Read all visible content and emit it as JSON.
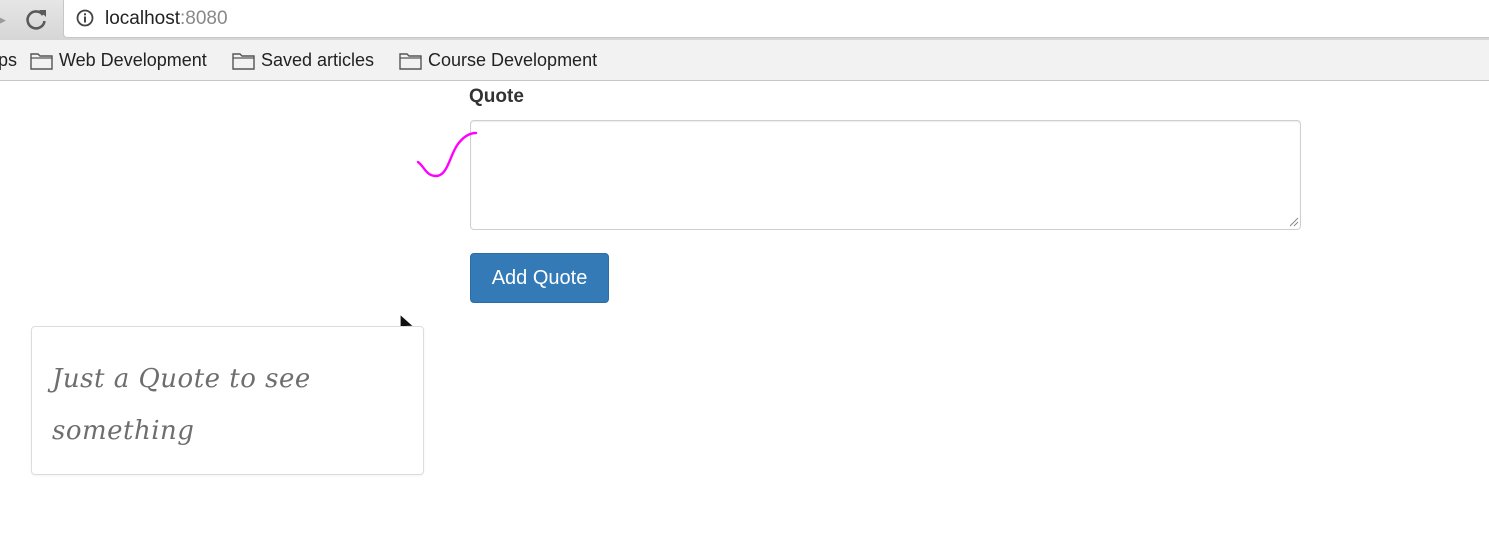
{
  "browser": {
    "url_host": "localhost",
    "url_port": ":8080",
    "bookmarks_partial": "ps",
    "bookmarks": [
      {
        "label": "Web Development",
        "icon": "folder-icon"
      },
      {
        "label": "Saved articles",
        "icon": "folder-icon"
      },
      {
        "label": "Course Development",
        "icon": "folder-icon"
      }
    ]
  },
  "form": {
    "quote_label": "Quote",
    "quote_value": "",
    "submit_label": "Add Quote"
  },
  "quotes": [
    {
      "text": "Just a Quote to see something"
    }
  ],
  "colors": {
    "primary_button": "#337ab7",
    "annotation": "#ff00ff",
    "quote_text": "#6e6e6e"
  }
}
